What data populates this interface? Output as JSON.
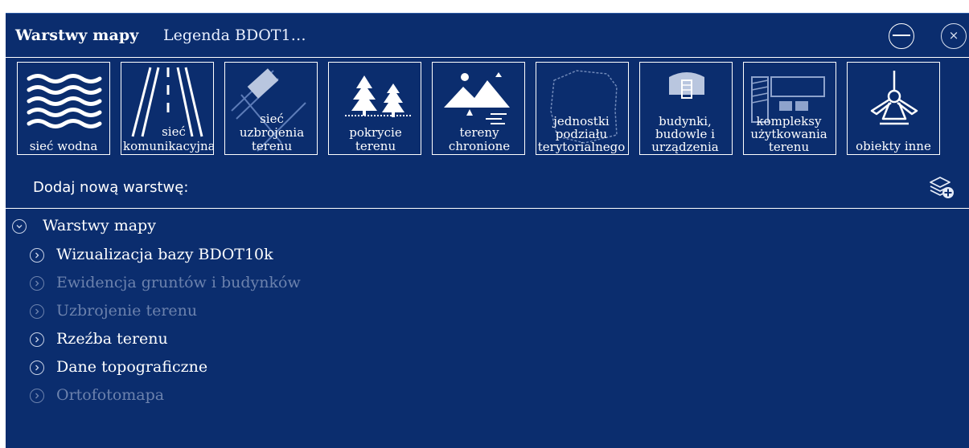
{
  "window": {
    "title": "Warstwy mapy",
    "subtitle": "Legenda BDOT1…"
  },
  "tiles": [
    {
      "label": "sieć wodna",
      "icon": "water-waves-icon"
    },
    {
      "label": "sieć komunikacyjna",
      "icon": "road-icon"
    },
    {
      "label": "sieć uzbrojenia terenu",
      "icon": "utility-network-icon"
    },
    {
      "label": "pokrycie terenu",
      "icon": "trees-icon"
    },
    {
      "label": "tereny chronione",
      "icon": "mountains-icon"
    },
    {
      "label": "jednostki podziału terytorialnego",
      "icon": "territory-map-icon"
    },
    {
      "label": "budynki, budowle i urządzenia",
      "icon": "building-icon"
    },
    {
      "label": "kompleksy użytkowania terenu",
      "icon": "land-use-complex-icon"
    },
    {
      "label": "obiekty inne",
      "icon": "windmill-icon"
    }
  ],
  "add_layer": {
    "label": "Dodaj nową warstwę:",
    "icon": "add-layer-icon"
  },
  "tree": {
    "root": "Warstwy mapy",
    "items": [
      {
        "label": "Wizualizacja bazy BDOT10k",
        "enabled": true
      },
      {
        "label": "Ewidencja gruntów i budynków",
        "enabled": false
      },
      {
        "label": "Uzbrojenie terenu",
        "enabled": false
      },
      {
        "label": "Rzeźba terenu",
        "enabled": true
      },
      {
        "label": "Dane topograficzne",
        "enabled": true
      },
      {
        "label": "Ortofotomapa",
        "enabled": false
      }
    ]
  },
  "colors": {
    "panel_background": "#0b2d6e",
    "foreground": "#ffffff",
    "disabled_text": "#6c82ad"
  }
}
